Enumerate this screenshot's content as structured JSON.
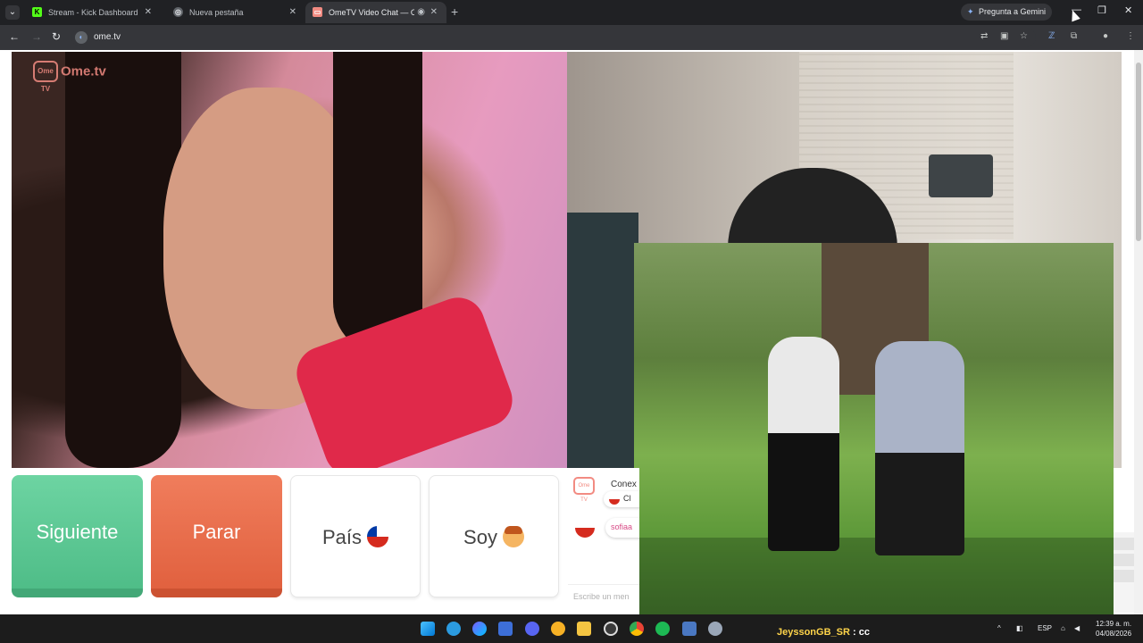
{
  "browser": {
    "tabs": [
      {
        "title": "Stream - Kick Dashboard",
        "favicon": "K",
        "color": "#53fc18",
        "active": false
      },
      {
        "title": "Nueva pestaña",
        "favicon": "◎",
        "color": "#9aa0a6",
        "active": false
      },
      {
        "title": "OmeTV Video Chat — Ome",
        "favicon": "▭",
        "color": "#f28b82",
        "active": true
      }
    ],
    "gemini_label": "Pregunta a Gemini",
    "url": "ome.tv"
  },
  "app": {
    "logo_badge": "Ome TV",
    "logo_text": "Ome.tv",
    "buttons": {
      "next": "Siguiente",
      "stop": "Parar",
      "country": "País",
      "gender": "Soy"
    },
    "chat": {
      "logo": "Ome TV",
      "connection_text": "Conex",
      "connection_country": "Cl",
      "message_user": "sofiaa",
      "input_placeholder": "Escribe un men"
    }
  },
  "taskbar": {
    "overlay_user": "JeyssonGB_SR",
    "overlay_text": ": cc",
    "language": "ESP",
    "time": "12:39 a. m.",
    "date": "04/08/2026"
  }
}
